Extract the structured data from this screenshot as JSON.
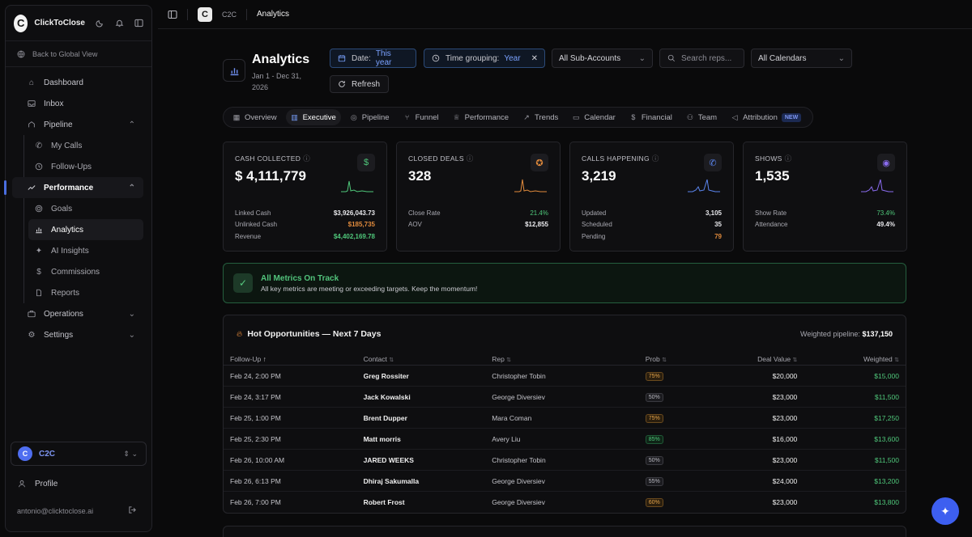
{
  "sidebar": {
    "brand": "ClickToClose",
    "back": "Back to Global View",
    "items": [
      {
        "label": "Dashboard"
      },
      {
        "label": "Inbox"
      },
      {
        "label": "Pipeline"
      },
      {
        "label": "My Calls"
      },
      {
        "label": "Follow-Ups"
      },
      {
        "label": "Performance"
      },
      {
        "label": "Goals"
      },
      {
        "label": "Analytics"
      },
      {
        "label": "AI Insights"
      },
      {
        "label": "Commissions"
      },
      {
        "label": "Reports"
      },
      {
        "label": "Operations"
      },
      {
        "label": "Settings"
      }
    ],
    "account_initial": "C",
    "account_name": "C2C",
    "profile": "Profile",
    "email": "antonio@clicktoclose.ai"
  },
  "topbar": {
    "logo": "C",
    "crumb1": "C2C",
    "crumb2": "Analytics"
  },
  "header": {
    "title": "Analytics",
    "subtitle": "Jan 1 - Dec 31, 2026"
  },
  "controls": {
    "date_key": "Date:",
    "date_val": "This year",
    "group_key": "Time grouping:",
    "group_val": "Year",
    "subaccounts": "All Sub-Accounts",
    "search_placeholder": "Search reps...",
    "calendars": "All Calendars",
    "refresh": "Refresh"
  },
  "tabs": [
    "Overview",
    "Executive",
    "Pipeline",
    "Funnel",
    "Performance",
    "Trends",
    "Calendar",
    "Financial",
    "Team",
    "Attribution"
  ],
  "tabs_new_badge": "NEW",
  "cards": [
    {
      "label": "CASH COLLECTED",
      "value": "$ 4,111,779",
      "icon": "dollar-icon",
      "color": "#4fc77a",
      "rows": [
        [
          "Linked Cash",
          "$3,926,043.73"
        ],
        [
          "Unlinked Cash",
          "$185,735"
        ],
        [
          "Revenue",
          "$4,402,169.78"
        ]
      ]
    },
    {
      "label": "CLOSED DEALS",
      "value": "328",
      "icon": "award-icon",
      "color": "#e08a3c",
      "rows": [
        [
          "Close Rate",
          "21.4%"
        ],
        [
          "AOV",
          "$12,855"
        ]
      ]
    },
    {
      "label": "CALLS HAPPENING",
      "value": "3,219",
      "icon": "phone-icon",
      "color": "#5b86f0",
      "rows": [
        [
          "Updated",
          "3,105"
        ],
        [
          "Scheduled",
          "35"
        ],
        [
          "Pending",
          "79"
        ]
      ]
    },
    {
      "label": "SHOWS",
      "value": "1,535",
      "icon": "eye-icon",
      "color": "#8a6cf0",
      "rows": [
        [
          "Show Rate",
          "73.4%"
        ],
        [
          "Attendance",
          "49.4%"
        ]
      ]
    }
  ],
  "alert": {
    "title": "All Metrics On Track",
    "text": "All key metrics are meeting or exceeding targets. Keep the momentum!"
  },
  "table": {
    "title": "Hot Opportunities — Next 7 Days",
    "weighted_label": "Weighted pipeline:",
    "weighted_value": "$137,150",
    "headers": [
      "Follow-Up",
      "Contact",
      "Rep",
      "Prob",
      "Deal Value",
      "Weighted"
    ],
    "rows": [
      [
        "Feb 24, 2:00 PM",
        "Greg Rossiter",
        "Christopher Tobin",
        "75%",
        "$20,000",
        "$15,000"
      ],
      [
        "Feb 24, 3:17 PM",
        "Jack Kowalski",
        "George Diversiev",
        "50%",
        "$23,000",
        "$11,500"
      ],
      [
        "Feb 25, 1:00 PM",
        "Brent Dupper",
        "Mara Coman",
        "75%",
        "$23,000",
        "$17,250"
      ],
      [
        "Feb 25, 2:30 PM",
        "Matt morris",
        "Avery Liu",
        "85%",
        "$16,000",
        "$13,600"
      ],
      [
        "Feb 26, 10:00 AM",
        "JARED WEEKS",
        "Christopher Tobin",
        "50%",
        "$23,000",
        "$11,500"
      ],
      [
        "Feb 26, 6:13 PM",
        "Dhiraj Sakumalla",
        "George Diversiev",
        "55%",
        "$24,000",
        "$13,200"
      ],
      [
        "Feb 26, 7:00 PM",
        "Robert Frost",
        "George Diversiev",
        "60%",
        "$23,000",
        "$13,800"
      ]
    ]
  }
}
